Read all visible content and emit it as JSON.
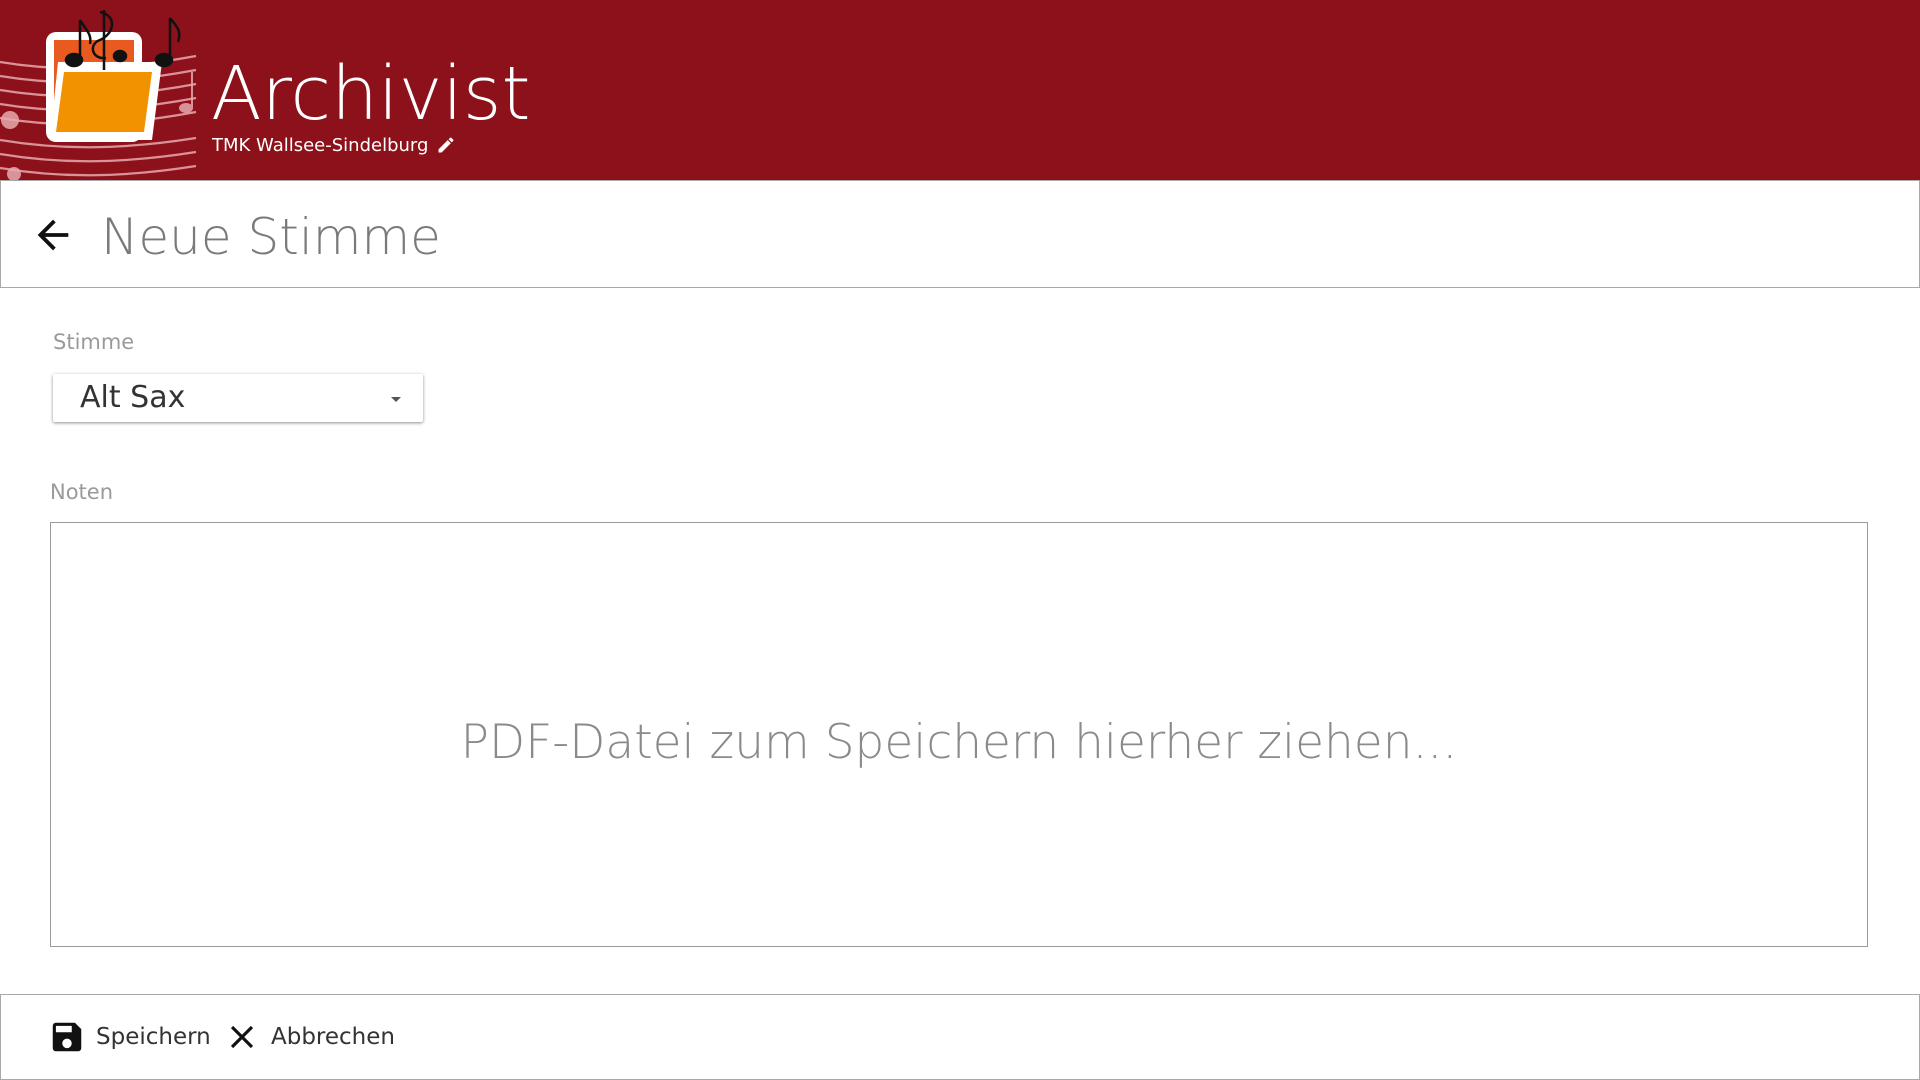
{
  "app": {
    "title": "Archivist",
    "organization": "TMK Wallsee-Sindelburg",
    "logo_icon": "folder-music-logo-icon",
    "edit_icon": "pencil-icon",
    "brand_color": "#8d111a"
  },
  "page": {
    "title": "Neue Stimme",
    "back_icon": "arrow-left-icon"
  },
  "form": {
    "stimme_label": "Stimme",
    "stimme_value": "Alt Sax",
    "noten_label": "Noten",
    "dropzone_text": "PDF-Datei zum Speichern hierher ziehen..."
  },
  "footer": {
    "save_label": "Speichern",
    "save_icon": "floppy-disk-icon",
    "cancel_label": "Abbrechen",
    "cancel_icon": "close-icon"
  }
}
